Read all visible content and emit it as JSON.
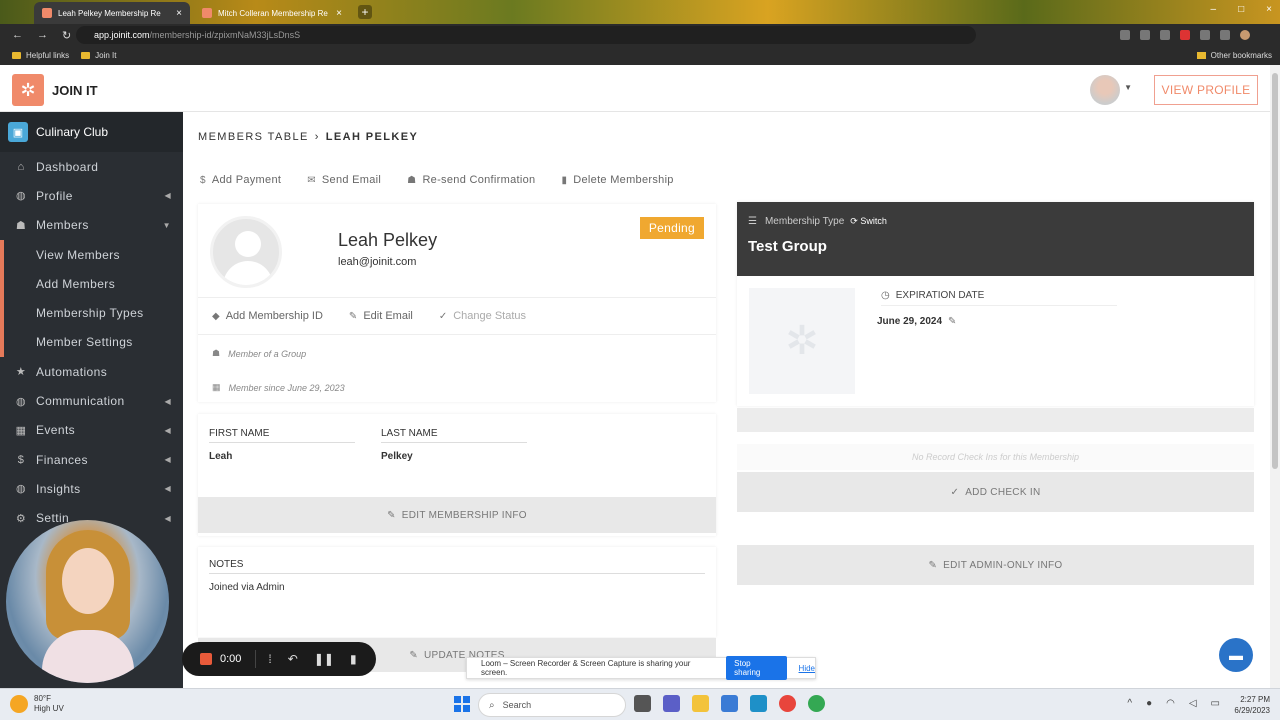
{
  "browser": {
    "tabs": [
      {
        "label": "Leah Pelkey Membership Re",
        "active": true
      },
      {
        "label": "Mitch Colleran Membership Re",
        "active": false
      }
    ],
    "url_host": "app.joinit.com",
    "url_path": "/membership-id/zpixmNaM33jLsDnsS",
    "bookmarks": [
      "Helpful links",
      "Join It"
    ],
    "other_bookmarks": "Other bookmarks"
  },
  "header": {
    "brand": "JOIN IT",
    "view_profile": "VIEW PROFILE"
  },
  "sidebar": {
    "club_name": "Culinary Club",
    "items": [
      {
        "label": "Dashboard",
        "icon": "home-icon"
      },
      {
        "label": "Profile",
        "icon": "globe-icon",
        "caret": true
      },
      {
        "label": "Members",
        "icon": "users-icon",
        "caret": true
      },
      {
        "label": "View Members",
        "sub": true
      },
      {
        "label": "Add Members",
        "sub": true
      },
      {
        "label": "Membership Types",
        "sub": true
      },
      {
        "label": "Member Settings",
        "sub": true
      },
      {
        "label": "Automations",
        "icon": "star-icon"
      },
      {
        "label": "Communication",
        "icon": "globe-icon",
        "caret": true
      },
      {
        "label": "Events",
        "icon": "calendar-icon",
        "caret": true
      },
      {
        "label": "Finances",
        "icon": "dollar-icon",
        "caret": true
      },
      {
        "label": "Insights",
        "icon": "globe-icon",
        "caret": true
      },
      {
        "label": "Settin",
        "icon": "gear-icon",
        "caret": true
      }
    ]
  },
  "breadcrumb": {
    "parent": "MEMBERS TABLE",
    "current": "LEAH PELKEY"
  },
  "actions": {
    "add_payment": "Add Payment",
    "send_email": "Send Email",
    "resend_confirmation": "Re-send Confirmation",
    "delete_membership": "Delete Membership"
  },
  "member": {
    "name": "Leah Pelkey",
    "email": "leah@joinit.com",
    "status": "Pending",
    "add_membership_id": "Add Membership ID",
    "edit_email": "Edit Email",
    "change_status": "Change Status",
    "group_note": "Member of a Group",
    "since_note": "Member since June 29, 2023"
  },
  "names": {
    "first_label": "FIRST NAME",
    "first_value": "Leah",
    "last_label": "LAST NAME",
    "last_value": "Pelkey",
    "edit_button": "EDIT MEMBERSHIP INFO"
  },
  "notes": {
    "label": "NOTES",
    "value": "Joined via Admin",
    "update_button": "UPDATE NOTES"
  },
  "membership_type": {
    "label": "Membership Type",
    "switch": "Switch",
    "name": "Test Group",
    "expiration_label": "EXPIRATION DATE",
    "expiration_value": "June 29, 2024",
    "no_checkins": "No Record Check Ins for this Membership",
    "add_checkin": "ADD CHECK IN",
    "edit_admin": "EDIT ADMIN-ONLY INFO"
  },
  "loom": {
    "timer": "0:00",
    "share_text": "Loom – Screen Recorder & Screen Capture is sharing your screen.",
    "stop": "Stop sharing",
    "hide": "Hide"
  },
  "taskbar": {
    "temp": "80°F",
    "uv": "High UV",
    "search": "Search",
    "time": "2:27 PM",
    "date": "6/29/2023"
  },
  "colors": {
    "accent": "#f08a6a",
    "status_pending": "#f0a830",
    "sidebar_bg": "#2a2e33",
    "card_header": "#3b3b3b"
  }
}
